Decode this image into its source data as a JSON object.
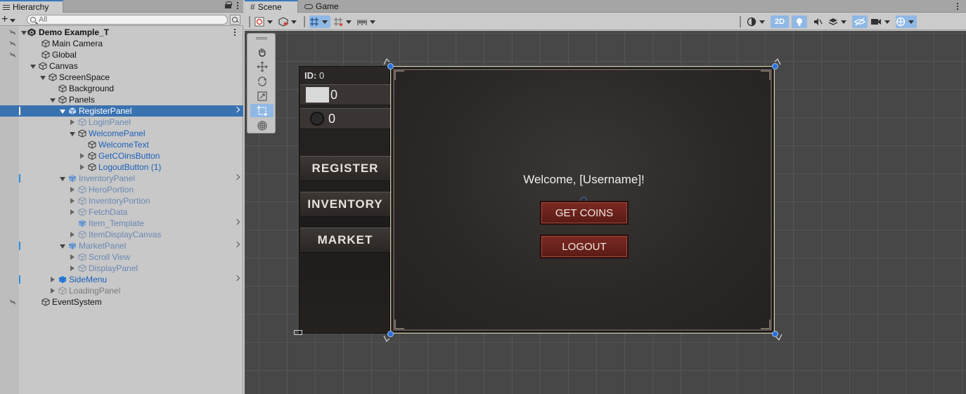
{
  "hierarchy": {
    "tab_label": "Hierarchy",
    "search_placeholder": "All",
    "add_label": "+",
    "scene_name": "Demo Example_T",
    "items": [
      {
        "label": "Main Camera"
      },
      {
        "label": "Global"
      },
      {
        "label": "Canvas"
      },
      {
        "label": "ScreenSpace"
      },
      {
        "label": "Background"
      },
      {
        "label": "Panels"
      },
      {
        "label": "RegisterPanel"
      },
      {
        "label": "LoginPanel"
      },
      {
        "label": "WelcomePanel"
      },
      {
        "label": "WelcomeText"
      },
      {
        "label": "GetCOinsButton"
      },
      {
        "label": "LogoutButton (1)"
      },
      {
        "label": "InventoryPanel"
      },
      {
        "label": "HeroPortion"
      },
      {
        "label": "InventoryPortion"
      },
      {
        "label": "FetchData"
      },
      {
        "label": "Item_Template"
      },
      {
        "label": "ItemDisplayCanvas"
      },
      {
        "label": "MarketPanel"
      },
      {
        "label": "Scroll View"
      },
      {
        "label": "DisplayPanel"
      },
      {
        "label": "SideMenu"
      },
      {
        "label": "LoadingPanel"
      },
      {
        "label": "EventSystem"
      }
    ]
  },
  "scene": {
    "tabs": [
      {
        "label": "Scene"
      },
      {
        "label": "Game"
      }
    ],
    "toolbar": {
      "mode_2d": "2D"
    }
  },
  "game_ui": {
    "id_label": "ID:",
    "id_value": "0",
    "gems_value": "0",
    "coins_value": "0",
    "menu": {
      "register": "REGISTER",
      "inventory": "INVENTORY",
      "market": "MARKET"
    },
    "welcome_text": "Welcome, [Username]!",
    "get_coins": "GET COINS",
    "logout": "LOGOUT"
  },
  "colors": {
    "selection": "#3a72b0",
    "accent": "#3a79bb",
    "prefab_text": "#1c5fb8",
    "game_button": "#6a221c",
    "viewport_bg": "#474747"
  }
}
